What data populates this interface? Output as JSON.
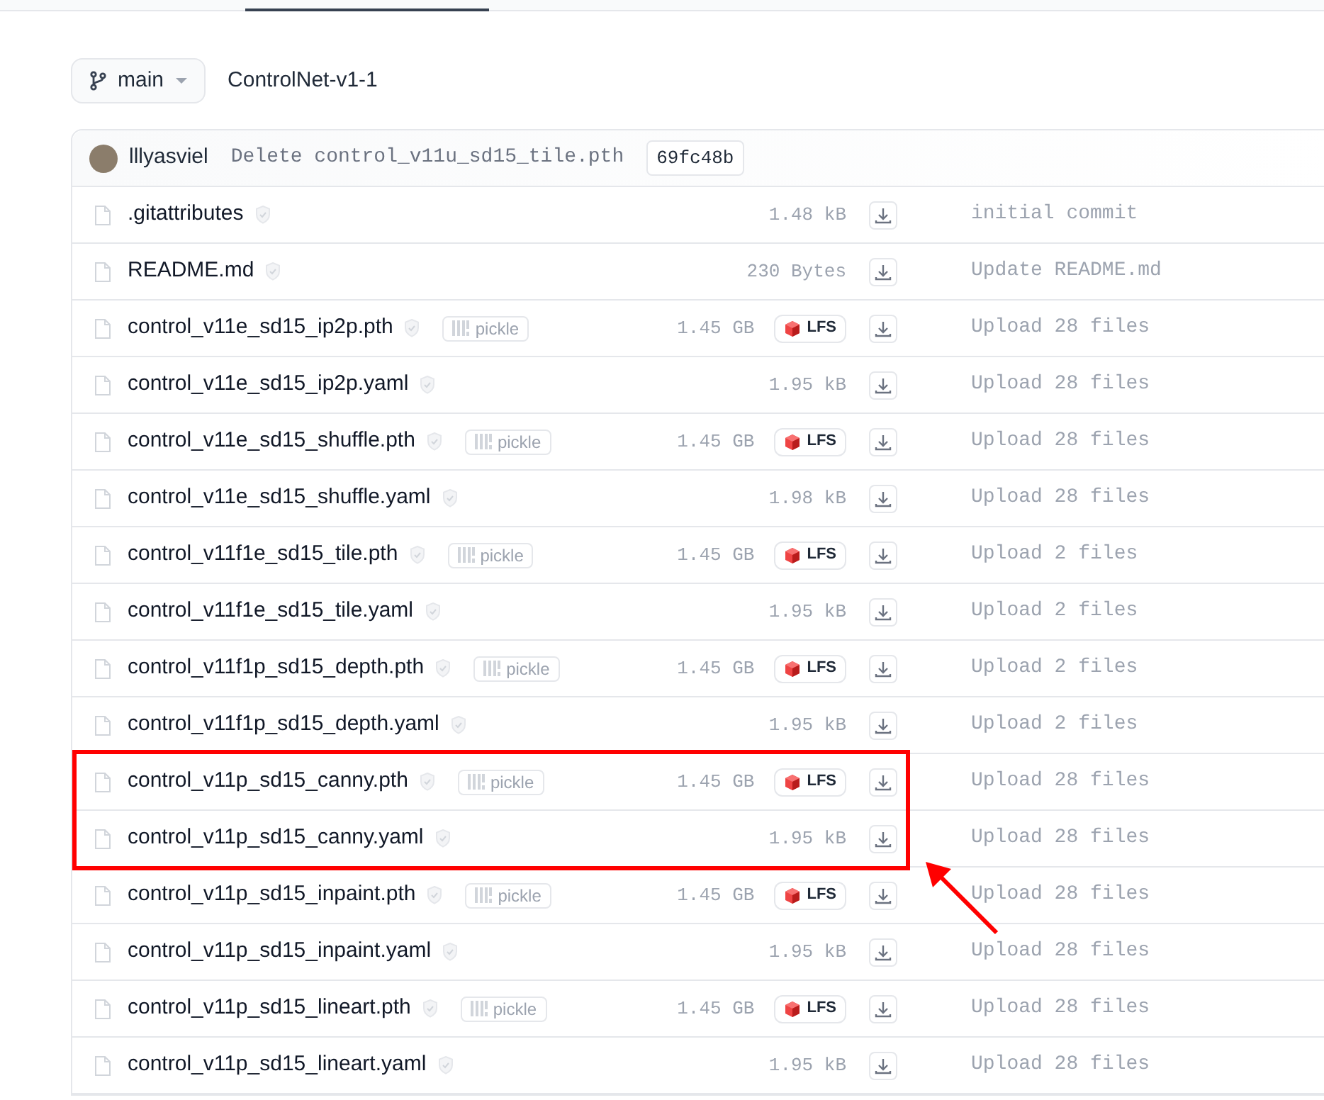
{
  "branch": {
    "label": "main"
  },
  "repo": {
    "name": "ControlNet-v1-1"
  },
  "last_commit": {
    "author": "lllyasviel",
    "message": "Delete control_v11u_sd15_tile.pth",
    "hash": "69fc48b"
  },
  "files": [
    {
      "name": ".gitattributes",
      "size": "1.48 kB",
      "commit": "initial commit",
      "highlighted": false
    },
    {
      "name": "README.md",
      "size": "230 Bytes",
      "commit": "Update README.md",
      "highlighted": false
    },
    {
      "name": "control_v11e_sd15_ip2p.pth",
      "pickle_badge": "pickle",
      "size": "1.45 GB",
      "lfs_badge": "LFS",
      "commit": "Upload 28 files",
      "highlighted": false
    },
    {
      "name": "control_v11e_sd15_ip2p.yaml",
      "size": "1.95 kB",
      "commit": "Upload 28 files",
      "highlighted": false
    },
    {
      "name": "control_v11e_sd15_shuffle.pth",
      "pickle_badge": "pickle",
      "size": "1.45 GB",
      "lfs_badge": "LFS",
      "commit": "Upload 28 files",
      "highlighted": false
    },
    {
      "name": "control_v11e_sd15_shuffle.yaml",
      "size": "1.98 kB",
      "commit": "Upload 28 files",
      "highlighted": false
    },
    {
      "name": "control_v11f1e_sd15_tile.pth",
      "pickle_badge": "pickle",
      "size": "1.45 GB",
      "lfs_badge": "LFS",
      "commit": "Upload 2 files",
      "highlighted": false
    },
    {
      "name": "control_v11f1e_sd15_tile.yaml",
      "size": "1.95 kB",
      "commit": "Upload 2 files",
      "highlighted": false
    },
    {
      "name": "control_v11f1p_sd15_depth.pth",
      "pickle_badge": "pickle",
      "size": "1.45 GB",
      "lfs_badge": "LFS",
      "commit": "Upload 2 files",
      "highlighted": false
    },
    {
      "name": "control_v11f1p_sd15_depth.yaml",
      "size": "1.95 kB",
      "commit": "Upload 2 files",
      "highlighted": false
    },
    {
      "name": "control_v11p_sd15_canny.pth",
      "pickle_badge": "pickle",
      "size": "1.45 GB",
      "lfs_badge": "LFS",
      "commit": "Upload 28 files",
      "highlighted": true
    },
    {
      "name": "control_v11p_sd15_canny.yaml",
      "size": "1.95 kB",
      "commit": "Upload 28 files",
      "highlighted": true
    },
    {
      "name": "control_v11p_sd15_inpaint.pth",
      "pickle_badge": "pickle",
      "size": "1.45 GB",
      "lfs_badge": "LFS",
      "commit": "Upload 28 files",
      "highlighted": false
    },
    {
      "name": "control_v11p_sd15_inpaint.yaml",
      "size": "1.95 kB",
      "commit": "Upload 28 files",
      "highlighted": false
    },
    {
      "name": "control_v11p_sd15_lineart.pth",
      "pickle_badge": "pickle",
      "size": "1.45 GB",
      "lfs_badge": "LFS",
      "commit": "Upload 28 files",
      "highlighted": false
    },
    {
      "name": "control_v11p_sd15_lineart.yaml",
      "size": "1.95 kB",
      "commit": "Upload 28 files",
      "highlighted": false
    }
  ]
}
